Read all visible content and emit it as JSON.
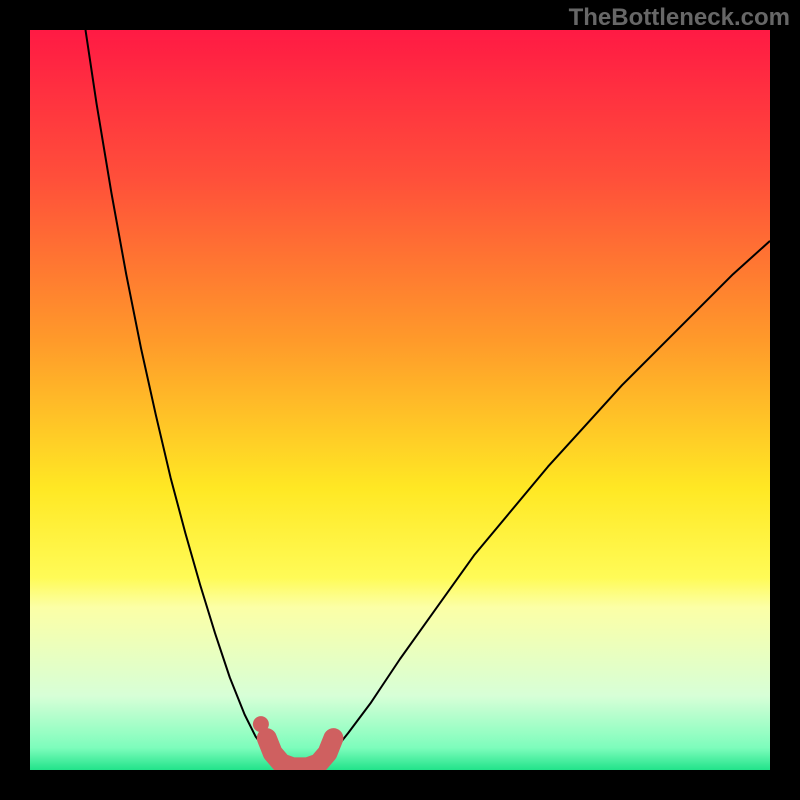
{
  "watermark": "TheBottleneck.com",
  "chart_data": {
    "type": "line",
    "title": "",
    "xlabel": "",
    "ylabel": "",
    "xlim": [
      0,
      100
    ],
    "ylim": [
      0,
      100
    ],
    "background_gradient": {
      "stops": [
        {
          "offset": 0.0,
          "color": "#ff1a44"
        },
        {
          "offset": 0.2,
          "color": "#ff4f3a"
        },
        {
          "offset": 0.42,
          "color": "#ff9a2a"
        },
        {
          "offset": 0.62,
          "color": "#ffe824"
        },
        {
          "offset": 0.74,
          "color": "#fffb57"
        },
        {
          "offset": 0.78,
          "color": "#fcffa6"
        },
        {
          "offset": 0.9,
          "color": "#d7ffd7"
        },
        {
          "offset": 0.97,
          "color": "#7dfdbc"
        },
        {
          "offset": 1.0,
          "color": "#22e38a"
        }
      ]
    },
    "series": [
      {
        "name": "curve-left",
        "color": "#000000",
        "width": 2,
        "x": [
          7.5,
          9,
          11,
          13,
          15,
          17,
          19,
          21,
          23,
          25,
          27,
          29,
          30.5,
          32
        ],
        "values": [
          100,
          90,
          78,
          67,
          57,
          48,
          39.5,
          32,
          25,
          18.5,
          12.5,
          7.5,
          4.5,
          2.5
        ]
      },
      {
        "name": "curve-right",
        "color": "#000000",
        "width": 2,
        "x": [
          41,
          43,
          46,
          50,
          55,
          60,
          65,
          70,
          75,
          80,
          85,
          90,
          95,
          100
        ],
        "values": [
          2.5,
          5,
          9,
          15,
          22,
          29,
          35,
          41,
          46.5,
          52,
          57,
          62,
          67,
          71.5
        ]
      },
      {
        "name": "marker-dot",
        "type": "scatter",
        "color": "#cf6060",
        "x": [
          31.2
        ],
        "values": [
          6.2
        ]
      },
      {
        "name": "marker-trough",
        "color": "#cf6060",
        "width": 11,
        "linecap": "round",
        "x": [
          32.0,
          32.8,
          34.0,
          35.5,
          37.5,
          39.0,
          40.2,
          41.0
        ],
        "values": [
          4.3,
          2.3,
          0.9,
          0.35,
          0.35,
          0.9,
          2.3,
          4.3
        ]
      }
    ]
  }
}
